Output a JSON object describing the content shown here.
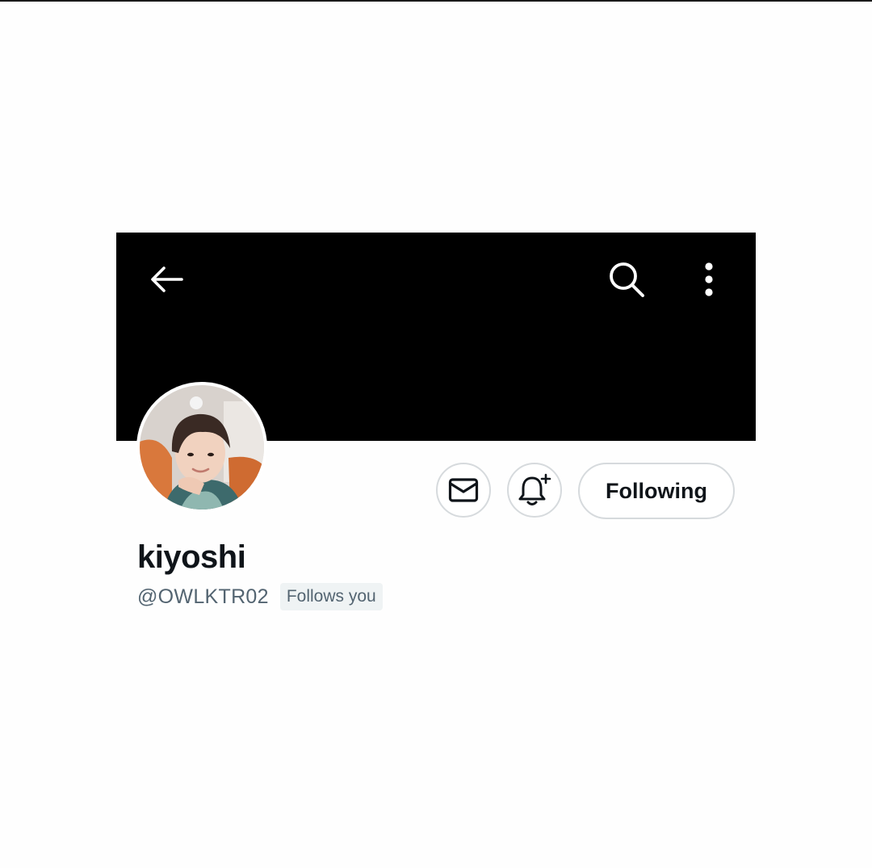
{
  "profile": {
    "display_name": "kiyoshi",
    "handle": "@OWLKTR02",
    "follows_you_label": "Follows you"
  },
  "actions": {
    "following_label": "Following"
  },
  "icons": {
    "back": "arrow-left-icon",
    "search": "search-icon",
    "more": "more-vertical-icon",
    "message": "envelope-icon",
    "notify": "bell-plus-icon"
  },
  "colors": {
    "banner": "#000000",
    "text_primary": "#0f1419",
    "text_secondary": "#536471",
    "button_border": "#d6dadd",
    "badge_bg": "#eff3f4"
  }
}
